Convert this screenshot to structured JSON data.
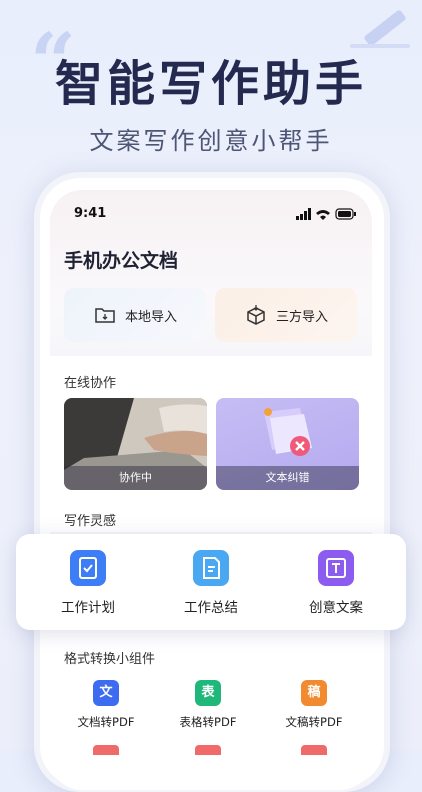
{
  "hero": {
    "title": "智能写作助手",
    "subtitle": "文案写作创意小帮手"
  },
  "status": {
    "time": "9:41"
  },
  "app": {
    "title": "手机办公文档"
  },
  "import": {
    "local": "本地导入",
    "third": "三方导入"
  },
  "collab": {
    "section": "在线协作",
    "card1": "协作中",
    "card2": "文本纠错"
  },
  "inspiration": {
    "section": "写作灵感",
    "items": [
      "工作计划",
      "工作总结",
      "创意文案"
    ]
  },
  "widgets": {
    "section": "格式转换小组件",
    "items": [
      {
        "label": "文档转PDF",
        "glyph": "文",
        "color": "#3d6cf0"
      },
      {
        "label": "表格转PDF",
        "glyph": "表",
        "color": "#1fb87a"
      },
      {
        "label": "文稿转PDF",
        "glyph": "稿",
        "color": "#f28a30"
      }
    ]
  },
  "colors": {
    "brand": "#24294f",
    "blue": "#3d7df5",
    "purple": "#8c5cf0"
  }
}
